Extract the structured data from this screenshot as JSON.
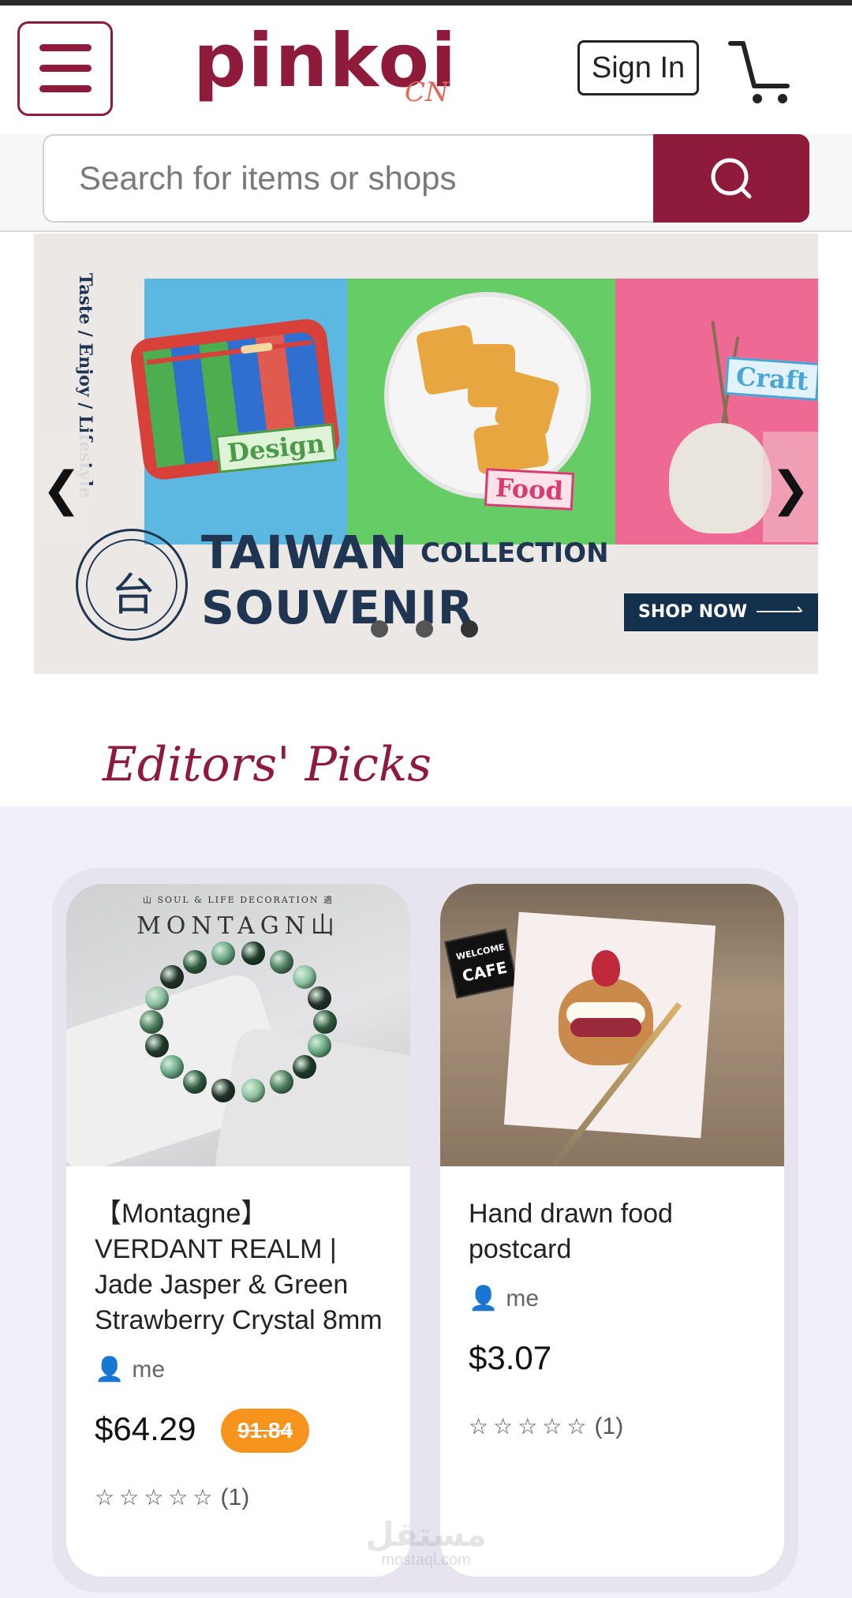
{
  "header": {
    "logo_text": "pinkoi",
    "logo_region": "CN",
    "sign_in_label": "Sign In"
  },
  "search": {
    "placeholder": "Search for items or shops"
  },
  "banner": {
    "vertical_text": "Taste / Enjoy / Lifestyle",
    "tags": [
      "Design",
      "Food",
      "Craft"
    ],
    "headline_1": "TAIWAN",
    "headline_collection": "COLLECTION",
    "headline_2": "SOUVENIR",
    "cta_label": "SHOP NOW",
    "seal_glyph": "台",
    "slide_count": 3,
    "active_slide": 3
  },
  "editors_picks": {
    "title": "Editors' Picks",
    "products": [
      {
        "image_brand_small": "山 SOUL & LIFE DECORATION 適",
        "image_brand": "MONTAGN山",
        "title": "【Montagne】VERDANT REALM | Jade Jasper & Green Strawberry Crystal 8mm",
        "shop": "me",
        "price": "$64.29",
        "original_price": "91.84",
        "rating_stars": "☆☆☆☆☆",
        "rating_count": "(1)"
      },
      {
        "image_sign_1": "WELCOME",
        "image_sign_2": "CAFE",
        "title": "Hand drawn food postcard",
        "shop": "me",
        "price": "$3.07",
        "rating_stars": "☆☆☆☆☆",
        "rating_count": "(1)"
      }
    ]
  },
  "icons": {
    "menu": "hamburger-menu-icon",
    "cart": "shopping-cart-icon",
    "search": "search-icon",
    "user": "user-icon",
    "prev": "chevron-left-icon",
    "next": "chevron-right-icon"
  },
  "colors": {
    "brand": "#8e1a3c",
    "accent_orange": "#f7941e",
    "section_bg": "#f1edf9",
    "banner_navy": "#1f3552"
  },
  "watermark": {
    "text": "مستقل",
    "sub": "mostaql.com"
  }
}
